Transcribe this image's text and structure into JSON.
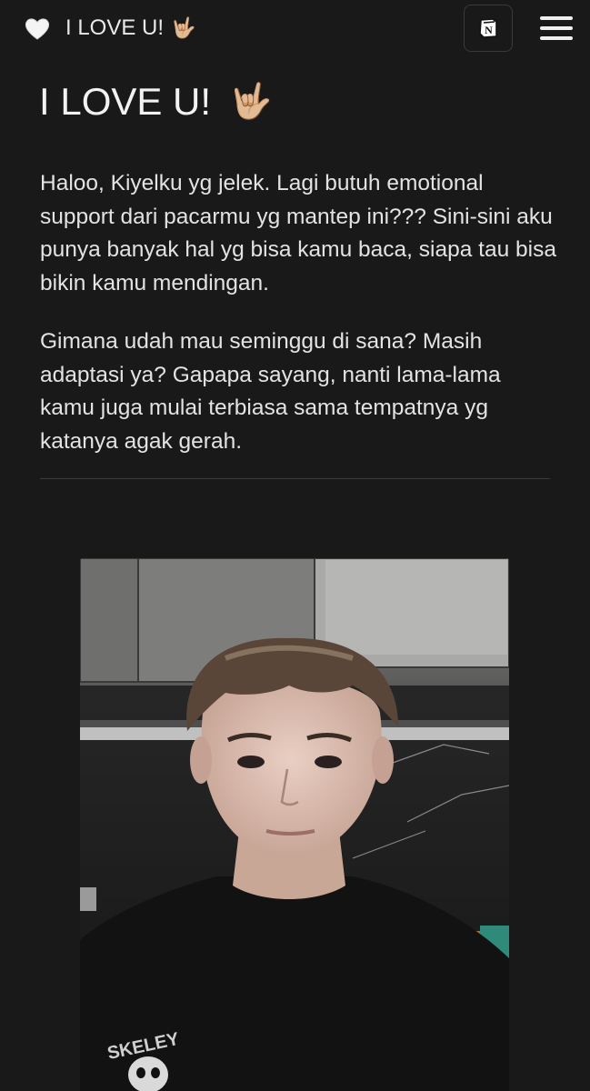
{
  "topbar": {
    "heart_icon": "white-heart-icon",
    "title": "I LOVE U!",
    "rock_emoji": "🤟🏼",
    "notion_label": "N",
    "menu_icon": "hamburger-menu-icon"
  },
  "page": {
    "title": "I LOVE U!",
    "rock_emoji": "🤟🏼",
    "paragraphs": [
      "Haloo, Kiyelku yg jelek. Lagi butuh emotional support dari pacarmu yg mantep ini??? Sini-sini aku punya banyak hal yg bisa kamu baca, siapa tau bisa bikin kamu mendingan.",
      "Gimana udah mau seminggu di sana? Masih adaptasi ya? Gapapa sayang, nanti lama-lama kamu juga mulai terbiasa sama tempatnya yg katanya agak gerah."
    ],
    "shirt_text": "SKELEY"
  },
  "colors": {
    "background": "#191919",
    "text": "#e3e3e3",
    "divider": "#3b3b3b"
  }
}
